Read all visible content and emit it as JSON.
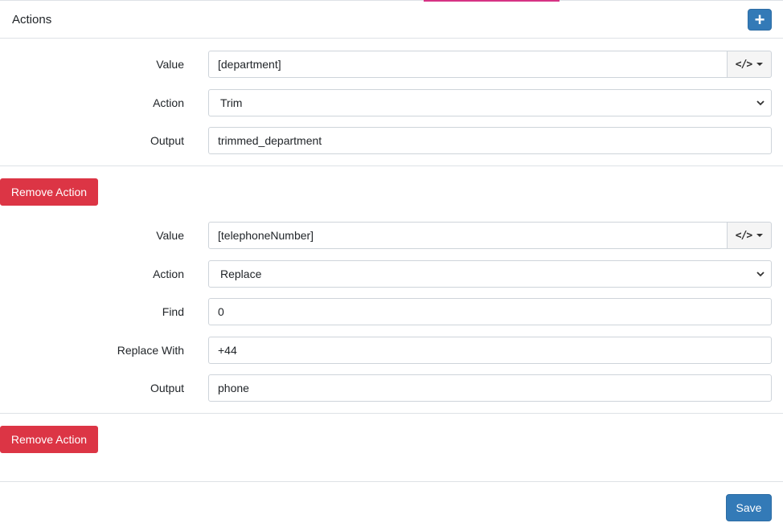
{
  "header": {
    "title": "Actions",
    "add_icon": "plus-icon",
    "add_label": "+"
  },
  "actions": [
    {
      "value": {
        "label": "Value",
        "input": "[department]",
        "addon_icon": "code-icon",
        "addon_glyph": "</>"
      },
      "action": {
        "label": "Action",
        "selected": "Trim"
      },
      "output": {
        "label": "Output",
        "input": "trimmed_department"
      },
      "remove_label": "Remove Action"
    },
    {
      "value": {
        "label": "Value",
        "input": "[telephoneNumber]",
        "addon_icon": "code-icon",
        "addon_glyph": "</>"
      },
      "action": {
        "label": "Action",
        "selected": "Replace"
      },
      "find": {
        "label": "Find",
        "input": "0"
      },
      "replace_with": {
        "label": "Replace With",
        "input": "+44"
      },
      "output": {
        "label": "Output",
        "input": "phone"
      },
      "remove_label": "Remove Action"
    }
  ],
  "footer": {
    "save_label": "Save"
  },
  "colors": {
    "primary": "#337ab7",
    "danger": "#dc3545",
    "accent": "#d63384",
    "border": "#dee2e6"
  }
}
